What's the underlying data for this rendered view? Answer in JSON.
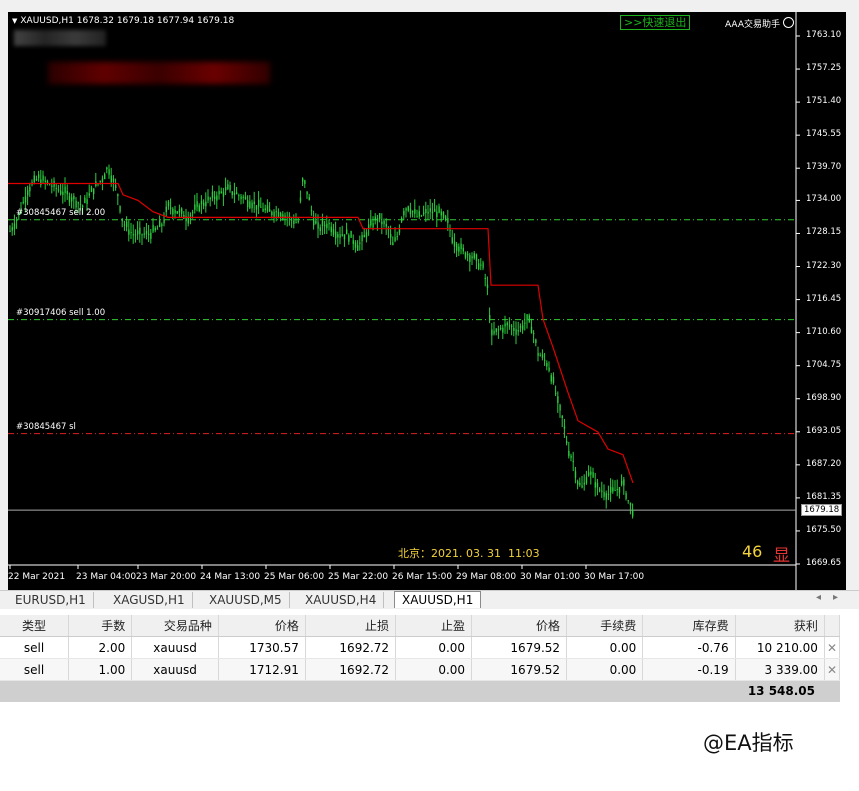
{
  "chart": {
    "symbol_header": "XAUUSD,H1  1678.32 1679.18 1677.94 1679.18",
    "fast_exit_label": ">>快速退出",
    "assistant_label": "AAA交易助手",
    "clock_text": "北京：2021. 03. 31  11:03",
    "count": "46",
    "show_label": "显",
    "current_price": "1679.18",
    "price_axis": [
      "1763.10",
      "1757.25",
      "1751.40",
      "1745.55",
      "1739.70",
      "1734.00",
      "1728.15",
      "1722.30",
      "1716.45",
      "1710.60",
      "1704.75",
      "1698.90",
      "1693.05",
      "1687.20",
      "1681.35",
      "1675.50",
      "1669.65"
    ],
    "time_axis": [
      "22 Mar 2021",
      "23 Mar 04:00",
      "23 Mar 20:00",
      "24 Mar 13:00",
      "25 Mar 06:00",
      "25 Mar 22:00",
      "26 Mar 15:00",
      "29 Mar 08:00",
      "30 Mar 01:00",
      "30 Mar 17:00"
    ],
    "order_lines": [
      {
        "label": "#30845467 sell 2.00",
        "color": "#33cc33",
        "price": 1730.57
      },
      {
        "label": "#30917406 sell 1.00",
        "color": "#33cc33",
        "price": 1712.91
      },
      {
        "label": "#30845467 sl",
        "color": "#e02020",
        "price": 1692.72
      }
    ],
    "colors": {
      "bull": "#2ecc40",
      "bear": "#2ecc40",
      "stop_line": "#e00000",
      "background": "#000000"
    }
  },
  "tabs": [
    "EURUSD,H1",
    "XAGUSD,H1",
    "XAUUSD,M5",
    "XAUUSD,H4",
    "XAUUSD,H1"
  ],
  "active_tab": "XAUUSD,H1",
  "table": {
    "headers": [
      "类型",
      "手数",
      "交易品种",
      "价格",
      "止损",
      "止盈",
      "价格",
      "手续费",
      "库存费",
      "获利"
    ],
    "rows": [
      [
        "sell",
        "2.00",
        "xauusd",
        "1730.57",
        "1692.72",
        "0.00",
        "1679.52",
        "0.00",
        "-0.76",
        "10 210.00"
      ],
      [
        "sell",
        "1.00",
        "xauusd",
        "1712.91",
        "1692.72",
        "0.00",
        "1679.52",
        "0.00",
        "-0.19",
        "3 339.00"
      ]
    ],
    "total": "13 548.05"
  },
  "watermark": "@EA指标"
}
